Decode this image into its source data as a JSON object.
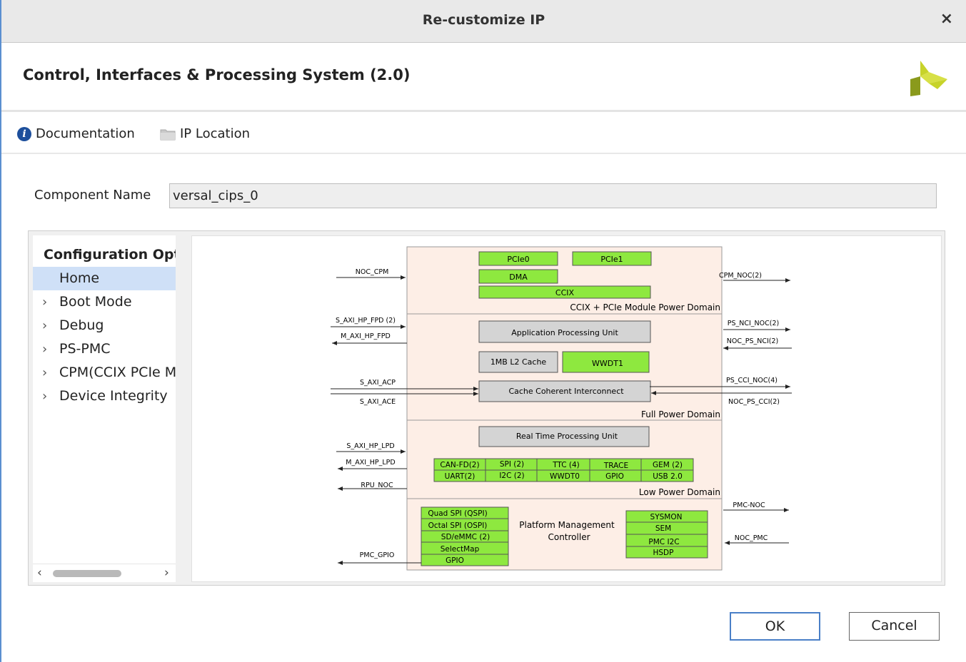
{
  "window": {
    "title": "Re-customize IP",
    "close_glyph": "×"
  },
  "header": {
    "ip_title": "Control, Interfaces & Processing System (2.0)",
    "logo_icon": "xilinx-logo-icon"
  },
  "toolbar": {
    "documentation": {
      "label": "Documentation",
      "icon": "info-icon"
    },
    "ip_location": {
      "label": "IP Location",
      "icon": "folder-icon"
    }
  },
  "component": {
    "label": "Component Name",
    "value": "versal_cips_0"
  },
  "nav": {
    "heading": "Configuration Options",
    "items": [
      {
        "label": "Home",
        "expandable": false,
        "selected": true
      },
      {
        "label": "Boot Mode",
        "expandable": true
      },
      {
        "label": "Debug",
        "expandable": true
      },
      {
        "label": "PS-PMC",
        "expandable": true
      },
      {
        "label": "CPM(CCIX PCIe Module)",
        "expandable": true
      },
      {
        "label": "Device Integrity",
        "expandable": true
      }
    ],
    "scroll_left": "‹",
    "scroll_right": "›"
  },
  "diagram": {
    "colors": {
      "domain_fill": "#fdeee6",
      "domain_border": "#9a9a9a",
      "block_green": "#8ee83f",
      "block_gray": "#d4d4d4"
    },
    "domains": {
      "cpm": "CCIX + PCIe Module Power Domain",
      "full": "Full Power Domain",
      "low": "Low Power Domain"
    },
    "blocks": {
      "pcie0": "PCIe0",
      "pcie1": "PCIe1",
      "dma": "DMA",
      "ccix": "CCIX",
      "apu": "Application Processing Unit",
      "l2": "1MB L2 Cache",
      "wwdt1": "WWDT1",
      "cci": "Cache Coherent Interconnect",
      "rpu": "Real Time Processing Unit",
      "io_grid": [
        [
          "CAN-FD(2)",
          "SPI (2)",
          "TTC (4)",
          "TRACE",
          "GEM (2)"
        ],
        [
          "UART(2)",
          "I2C (2)",
          "WWDT0",
          "GPIO",
          "USB 2.0"
        ]
      ],
      "pmc_left": [
        "Quad SPI (QSPI)",
        "Octal SPI (OSPI)",
        "SD/eMMC (2)",
        "SelectMap",
        "GPIO"
      ],
      "pmc_label_1": "Platform Management",
      "pmc_label_2": "Controller",
      "pmc_right": [
        "SYSMON",
        "SEM",
        "PMC I2C",
        "HSDP"
      ]
    },
    "ports_left": {
      "noc_cpm": "NOC_CPM",
      "s_axi_hp_fpd": "S_AXI_HP_FPD (2)",
      "m_axi_hp_fpd": "M_AXI_HP_FPD",
      "s_axi_acp": "S_AXI_ACP",
      "s_axi_ace": "S_AXI_ACE",
      "s_axi_hp_lpd": "S_AXI_HP_LPD",
      "m_axi_hp_lpd": "M_AXI_HP_LPD",
      "rpu_noc": "RPU_NOC",
      "pmc_gpio": "PMC_GPIO"
    },
    "ports_right": {
      "cpm_noc": "CPM_NOC(2)",
      "ps_nci_noc": "PS_NCI_NOC(2)",
      "noc_ps_nci": "NOC_PS_NCI(2)",
      "ps_cci_noc": "PS_CCI_NOC(4)",
      "noc_ps_cci": "NOC_PS_CCI(2)",
      "pmc_noc": "PMC-NOC",
      "noc_pmc": "NOC_PMC"
    }
  },
  "buttons": {
    "ok": "OK",
    "cancel": "Cancel"
  }
}
